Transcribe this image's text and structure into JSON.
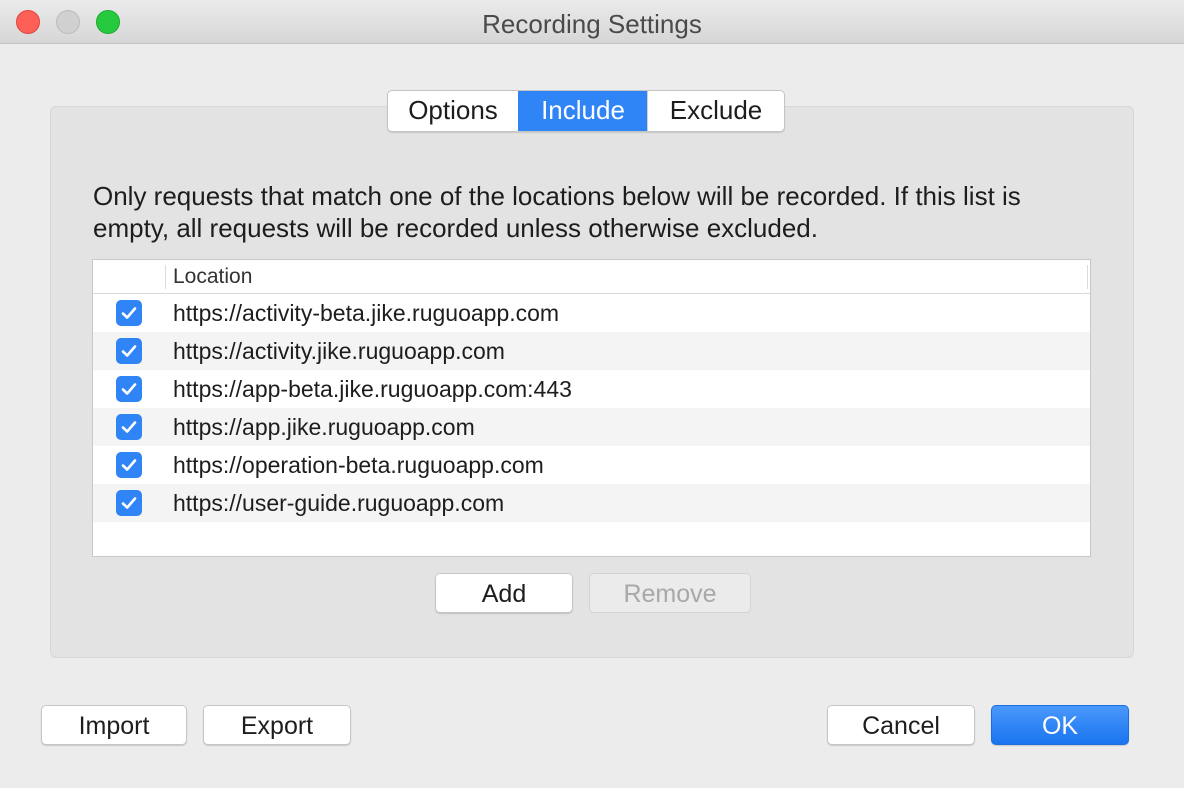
{
  "window": {
    "title": "Recording Settings"
  },
  "tabs": [
    {
      "label": "Options",
      "active": false
    },
    {
      "label": "Include",
      "active": true
    },
    {
      "label": "Exclude",
      "active": false
    }
  ],
  "description": "Only requests that match one of the locations below will be recorded. If this list is empty, all requests will be recorded unless otherwise excluded.",
  "table": {
    "columns": [
      "",
      "Location"
    ],
    "rows": [
      {
        "checked": true,
        "location": "https://activity-beta.jike.ruguoapp.com"
      },
      {
        "checked": true,
        "location": "https://activity.jike.ruguoapp.com"
      },
      {
        "checked": true,
        "location": "https://app-beta.jike.ruguoapp.com:443"
      },
      {
        "checked": true,
        "location": "https://app.jike.ruguoapp.com"
      },
      {
        "checked": true,
        "location": "https://operation-beta.ruguoapp.com"
      },
      {
        "checked": true,
        "location": "https://user-guide.ruguoapp.com"
      }
    ]
  },
  "list_buttons": {
    "add": "Add",
    "remove": "Remove"
  },
  "footer": {
    "import": "Import",
    "export": "Export",
    "cancel": "Cancel",
    "ok": "OK"
  },
  "colors": {
    "accent": "#2f84f6",
    "close": "#fe5f57",
    "maximize": "#27c93f"
  }
}
